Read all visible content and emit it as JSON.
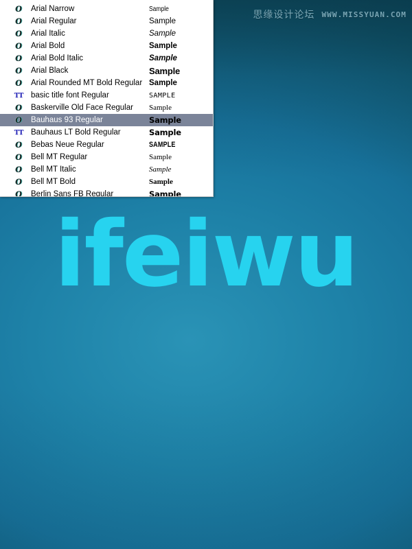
{
  "colors": {
    "background_top": "#0f4f63",
    "background_mid": "#2a93b6",
    "wordmark_cyan": "#27d3ef",
    "selection_blue": "#7b8499",
    "panel_white": "#ffffff",
    "opentype_icon_teal": "#3aa9a0",
    "truetype_icon_blue": "#2b2bbb",
    "watermark": "#a8d4e2"
  },
  "watermark": {
    "chinese": "思缘设计论坛",
    "url": "WWW.MISSYUAN.COM"
  },
  "wordmark": {
    "text": "ifeiwu"
  },
  "font_list": {
    "selected_index": 9,
    "rows": [
      {
        "icon": "opentype-icon",
        "icon_glyph": "O",
        "name": "Arial Narrow",
        "sample": "Sample",
        "sample_style": "s-narrow"
      },
      {
        "icon": "opentype-icon",
        "icon_glyph": "O",
        "name": "Arial Regular",
        "sample": "Sample",
        "sample_style": "s-regular"
      },
      {
        "icon": "opentype-icon",
        "icon_glyph": "O",
        "name": "Arial Italic",
        "sample": "Sample",
        "sample_style": "s-italic"
      },
      {
        "icon": "opentype-icon",
        "icon_glyph": "O",
        "name": "Arial Bold",
        "sample": "Sample",
        "sample_style": "s-bold"
      },
      {
        "icon": "opentype-icon",
        "icon_glyph": "O",
        "name": "Arial Bold Italic",
        "sample": "Sample",
        "sample_style": "s-bolditalic"
      },
      {
        "icon": "opentype-icon",
        "icon_glyph": "O",
        "name": "Arial Black",
        "sample": "Sample",
        "sample_style": "s-black"
      },
      {
        "icon": "opentype-icon",
        "icon_glyph": "O",
        "name": "Arial Rounded MT Bold Regular",
        "sample": "Sample",
        "sample_style": "s-rounded"
      },
      {
        "icon": "truetype-icon",
        "icon_glyph": "TT",
        "name": "basic title font Regular",
        "sample": "SAMPLE",
        "sample_style": "s-caps"
      },
      {
        "icon": "opentype-icon",
        "icon_glyph": "O",
        "name": "Baskerville Old Face Regular",
        "sample": "Sample",
        "sample_style": "s-serif"
      },
      {
        "icon": "opentype-icon",
        "icon_glyph": "O",
        "name": "Bauhaus 93 Regular",
        "sample": "Sample",
        "sample_style": "s-geo"
      },
      {
        "icon": "truetype-icon",
        "icon_glyph": "TT",
        "name": "Bauhaus LT Bold Regular",
        "sample": "Sample",
        "sample_style": "s-geo"
      },
      {
        "icon": "opentype-icon",
        "icon_glyph": "O",
        "name": "Bebas Neue Regular",
        "sample": "SAMPLE",
        "sample_style": "s-condcaps"
      },
      {
        "icon": "opentype-icon",
        "icon_glyph": "O",
        "name": "Bell MT Regular",
        "sample": "Sample",
        "sample_style": "s-serif"
      },
      {
        "icon": "opentype-icon",
        "icon_glyph": "O",
        "name": "Bell MT Italic",
        "sample": "Sample",
        "sample_style": "s-serifitalic"
      },
      {
        "icon": "opentype-icon",
        "icon_glyph": "O",
        "name": "Bell MT Bold",
        "sample": "Sample",
        "sample_style": "s-serifbold"
      },
      {
        "icon": "opentype-icon",
        "icon_glyph": "O",
        "name": "Berlin Sans FB Regular",
        "sample": "Sample",
        "sample_style": "s-geo"
      }
    ]
  }
}
